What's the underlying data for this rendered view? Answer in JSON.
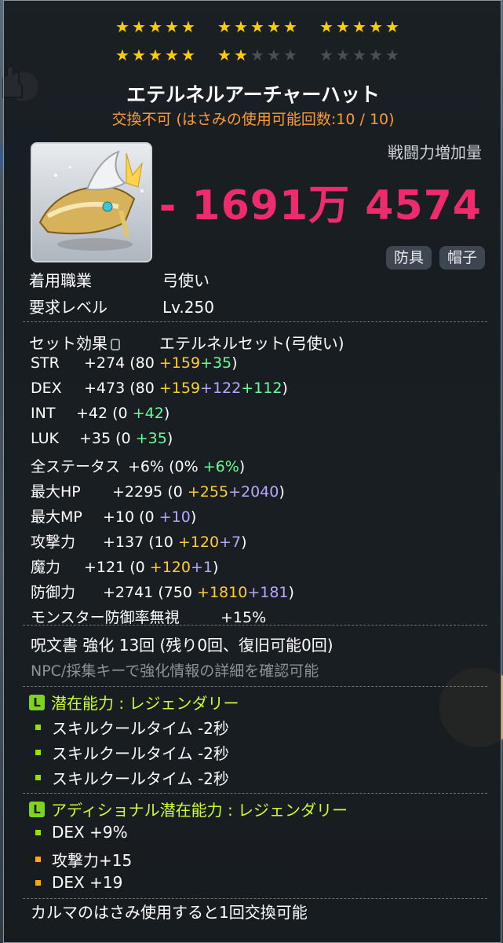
{
  "stars": {
    "rows": [
      [
        [
          5,
          5
        ],
        [
          5,
          5
        ],
        [
          5,
          5
        ]
      ],
      [
        [
          5,
          5
        ],
        [
          2,
          5
        ],
        [
          0,
          5
        ]
      ]
    ],
    "colors": {
      "on": "#ffcc00",
      "off": "#4a4f55"
    }
  },
  "item": {
    "name": "エテルネルアーチャーハット",
    "trade_note": "交換不可 (はさみの使用可能回数:10 / 10)",
    "icon": "archer-hat-icon"
  },
  "power": {
    "label": "戦闘力増加量",
    "value": "- 1691万 4574"
  },
  "tags": [
    "防具",
    "帽子"
  ],
  "requirements": [
    {
      "key": "着用職業",
      "value": "弓使い"
    },
    {
      "key": "要求レベル",
      "value": "Lv.250"
    }
  ],
  "set_effect": {
    "label": "セット効果",
    "value": "エテルネルセット(弓使い)"
  },
  "stats": [
    {
      "label": "STR",
      "total": "+274",
      "base": "80",
      "flame": "+159",
      "green": "+35"
    },
    {
      "label": "DEX",
      "total": "+473",
      "base": "80",
      "flame": "+159",
      "purple": "+122",
      "green": "+112"
    },
    {
      "label": "INT",
      "total": "+42",
      "base": "0",
      "green": "+42"
    },
    {
      "label": "LUK",
      "total": "+35",
      "base": "0",
      "green": "+35"
    },
    {
      "label": "全ステータス",
      "total": "+6%",
      "base": "0%",
      "green": "+6%"
    },
    {
      "label": "最大HP",
      "total": "+2295",
      "base": "0",
      "flame": "+255",
      "purple": "+2040"
    },
    {
      "label": "最大MP",
      "total": "+10",
      "base": "0",
      "purple": "+10"
    },
    {
      "label": "攻撃力",
      "total": "+137",
      "base": "10",
      "flame": "+120",
      "purple": "+7"
    },
    {
      "label": "魔力",
      "total": "+121",
      "base": "0",
      "flame": "+120",
      "purple": "+1"
    },
    {
      "label": "防御力",
      "total": "+2741",
      "base": "750",
      "flame": "+1810",
      "purple": "+181"
    },
    {
      "label": "モンスター防御率無視",
      "total": "+15%"
    }
  ],
  "scroll": {
    "line": "呪文書 強化 13回 (残り0回、復旧可能0回)",
    "hint": "NPC/採集キーで強化情報の詳細を確認可能"
  },
  "potential": {
    "header": "潜在能力 : レジェンダリー",
    "lines": [
      "スキルクールタイム -2秒",
      "スキルクールタイム -2秒",
      "スキルクールタイム -2秒"
    ]
  },
  "additional": {
    "header": "アディショナル潜在能力 : レジェンダリー",
    "lines": [
      "DEX +9%",
      "攻撃力+15",
      "DEX +19"
    ]
  },
  "footer": "カルマのはさみ使用すると1回交換可能"
}
